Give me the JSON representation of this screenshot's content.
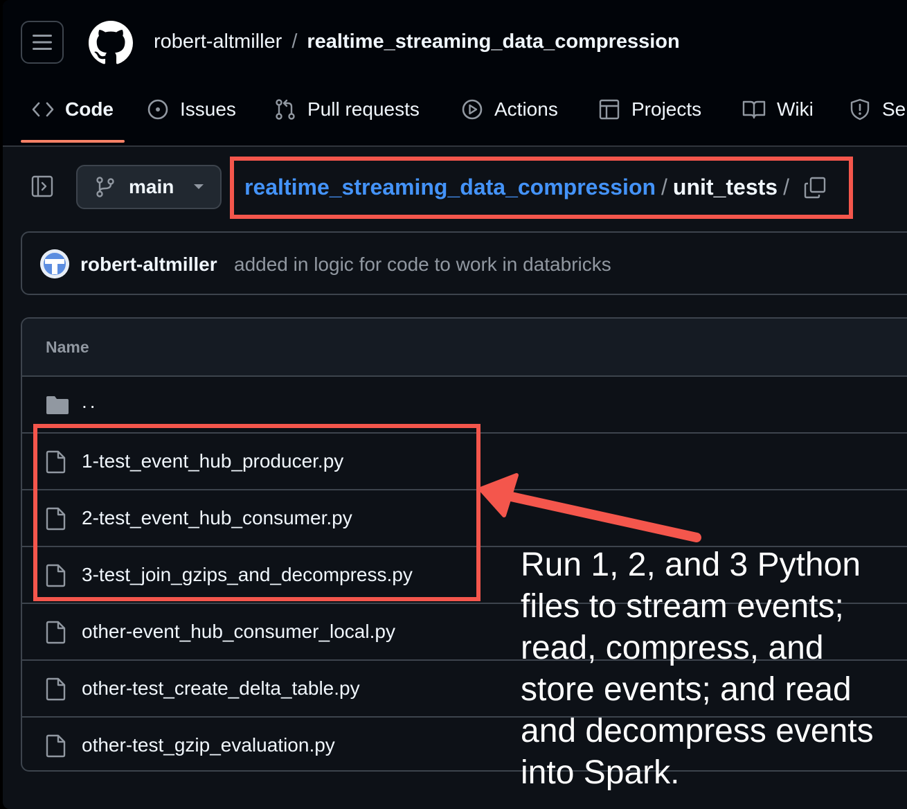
{
  "header": {
    "owner": "robert-altmiller",
    "separator": "/",
    "repo": "realtime_streaming_data_compression"
  },
  "tabs": [
    {
      "label": "Code",
      "icon": "code-icon",
      "active": true
    },
    {
      "label": "Issues",
      "icon": "issue-opened-icon"
    },
    {
      "label": "Pull requests",
      "icon": "git-pull-request-icon"
    },
    {
      "label": "Actions",
      "icon": "play-icon"
    },
    {
      "label": "Projects",
      "icon": "table-icon"
    },
    {
      "label": "Wiki",
      "icon": "book-icon"
    },
    {
      "label": "Se",
      "icon": "shield-icon"
    }
  ],
  "branch": {
    "label": "main",
    "icon": "git-branch-icon"
  },
  "breadcrumb": {
    "repo_link": "realtime_streaming_data_compression",
    "sep1": "/",
    "current": "unit_tests",
    "sep2": "/"
  },
  "commit": {
    "author": "robert-altmiller",
    "message": "added in logic for code to work in databricks"
  },
  "files": {
    "header": "Name",
    "parent": "..",
    "items": [
      "1-test_event_hub_producer.py",
      "2-test_event_hub_consumer.py",
      "3-test_join_gzips_and_decompress.py",
      "other-event_hub_consumer_local.py",
      "other-test_create_delta_table.py",
      "other-test_gzip_evaluation.py"
    ]
  },
  "annotation": {
    "text": "Run 1, 2, and 3 Python files to stream events; read, compress, and store events; and read and decompress events into Spark.",
    "color": "#f4564c"
  },
  "colors": {
    "bg": "#0d1117",
    "topbar": "#010409",
    "border": "#3d444d",
    "link": "#4493f8",
    "tab_underline": "#f78166",
    "highlight": "#f4564c"
  }
}
